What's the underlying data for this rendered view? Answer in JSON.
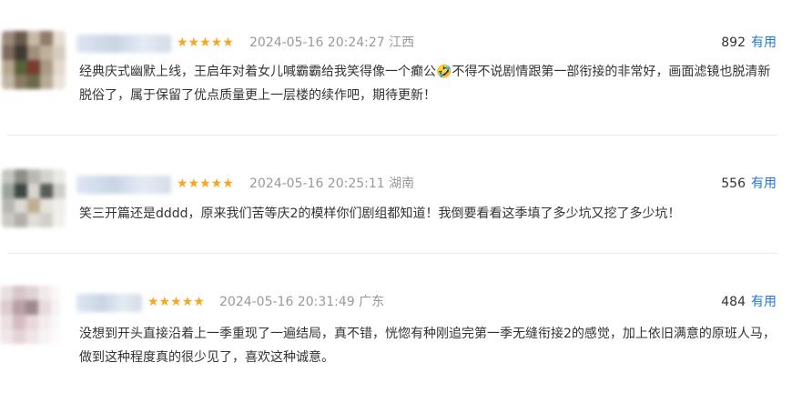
{
  "reviews": [
    {
      "rating_stars": "★★★★★",
      "date": "2024-05-16 20:24:27",
      "location": "江西",
      "useful_count": "892",
      "useful_label": "有用",
      "text": "经典庆式幽默上线，王启年对着女儿喊霸霸给我笑得像一个癫公🤣不得不说剧情跟第一部衔接的非常好，画面滤镜也脱清新脱俗了，属于保留了优点质量更上一层楼的续作吧，期待更新！"
    },
    {
      "rating_stars": "★★★★★",
      "date": "2024-05-16 20:25:11",
      "location": "湖南",
      "useful_count": "556",
      "useful_label": "有用",
      "text": "笑三开篇还是dddd，原来我们苦等庆2的模样你们剧组都知道！我倒要看看这季填了多少坑又挖了多少坑！"
    },
    {
      "rating_stars": "★★★★★",
      "date": "2024-05-16 20:31:49",
      "location": "广东",
      "useful_count": "484",
      "useful_label": "有用",
      "text": "没想到开头直接沿着上一季重现了一遍结局，真不错，恍惚有种刚追完第一季无缝衔接2的感觉，加上依旧满意的原班人马，做到这种程度真的很少见了，喜欢这种诚意。"
    }
  ],
  "colors": {
    "star": "#f5a623",
    "useful_link": "#1e77d6",
    "meta_text": "#999999",
    "divider": "#ececec"
  }
}
